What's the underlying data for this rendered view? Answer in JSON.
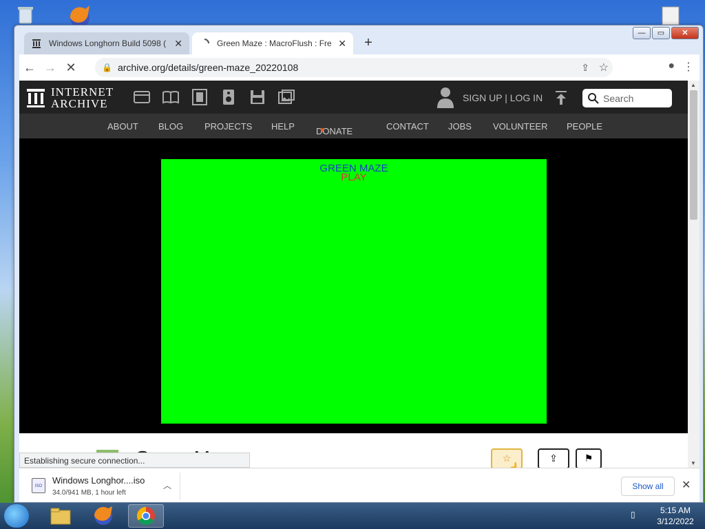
{
  "window": {
    "controls": {
      "minimize": "—",
      "maximize": "▭",
      "close": "✕"
    }
  },
  "tabs": [
    {
      "title": "Windows Longhorn Build 5098 (",
      "icon": "archive-icon"
    },
    {
      "title": "Green Maze : MacroFlush : Free D",
      "icon": "loading-icon"
    }
  ],
  "toolbar": {
    "url": "archive.org/details/green-maze_20220108"
  },
  "ia_header": {
    "logo_line1": "INTERNET",
    "logo_line2": "ARCHIVE",
    "sign": "SIGN UP | LOG IN",
    "search_placeholder": "Search"
  },
  "ia_nav": [
    "ABOUT",
    "BLOG",
    "PROJECTS",
    "HELP",
    "DONATE",
    "CONTACT",
    "JOBS",
    "VOLUNTEER",
    "PEOPLE"
  ],
  "game": {
    "title": "GREEN MAZE",
    "play": "PLAY",
    "background": "#00ff00"
  },
  "item": {
    "title": "Green Maze"
  },
  "status_text": "Establishing secure connection...",
  "download": {
    "name": "Windows Longhor....iso",
    "progress": "34.0/941 MB, 1 hour left",
    "show_all": "Show all",
    "file_tag": "ISO"
  },
  "clock": {
    "time": "5:15 AM",
    "date": "3/12/2022"
  }
}
